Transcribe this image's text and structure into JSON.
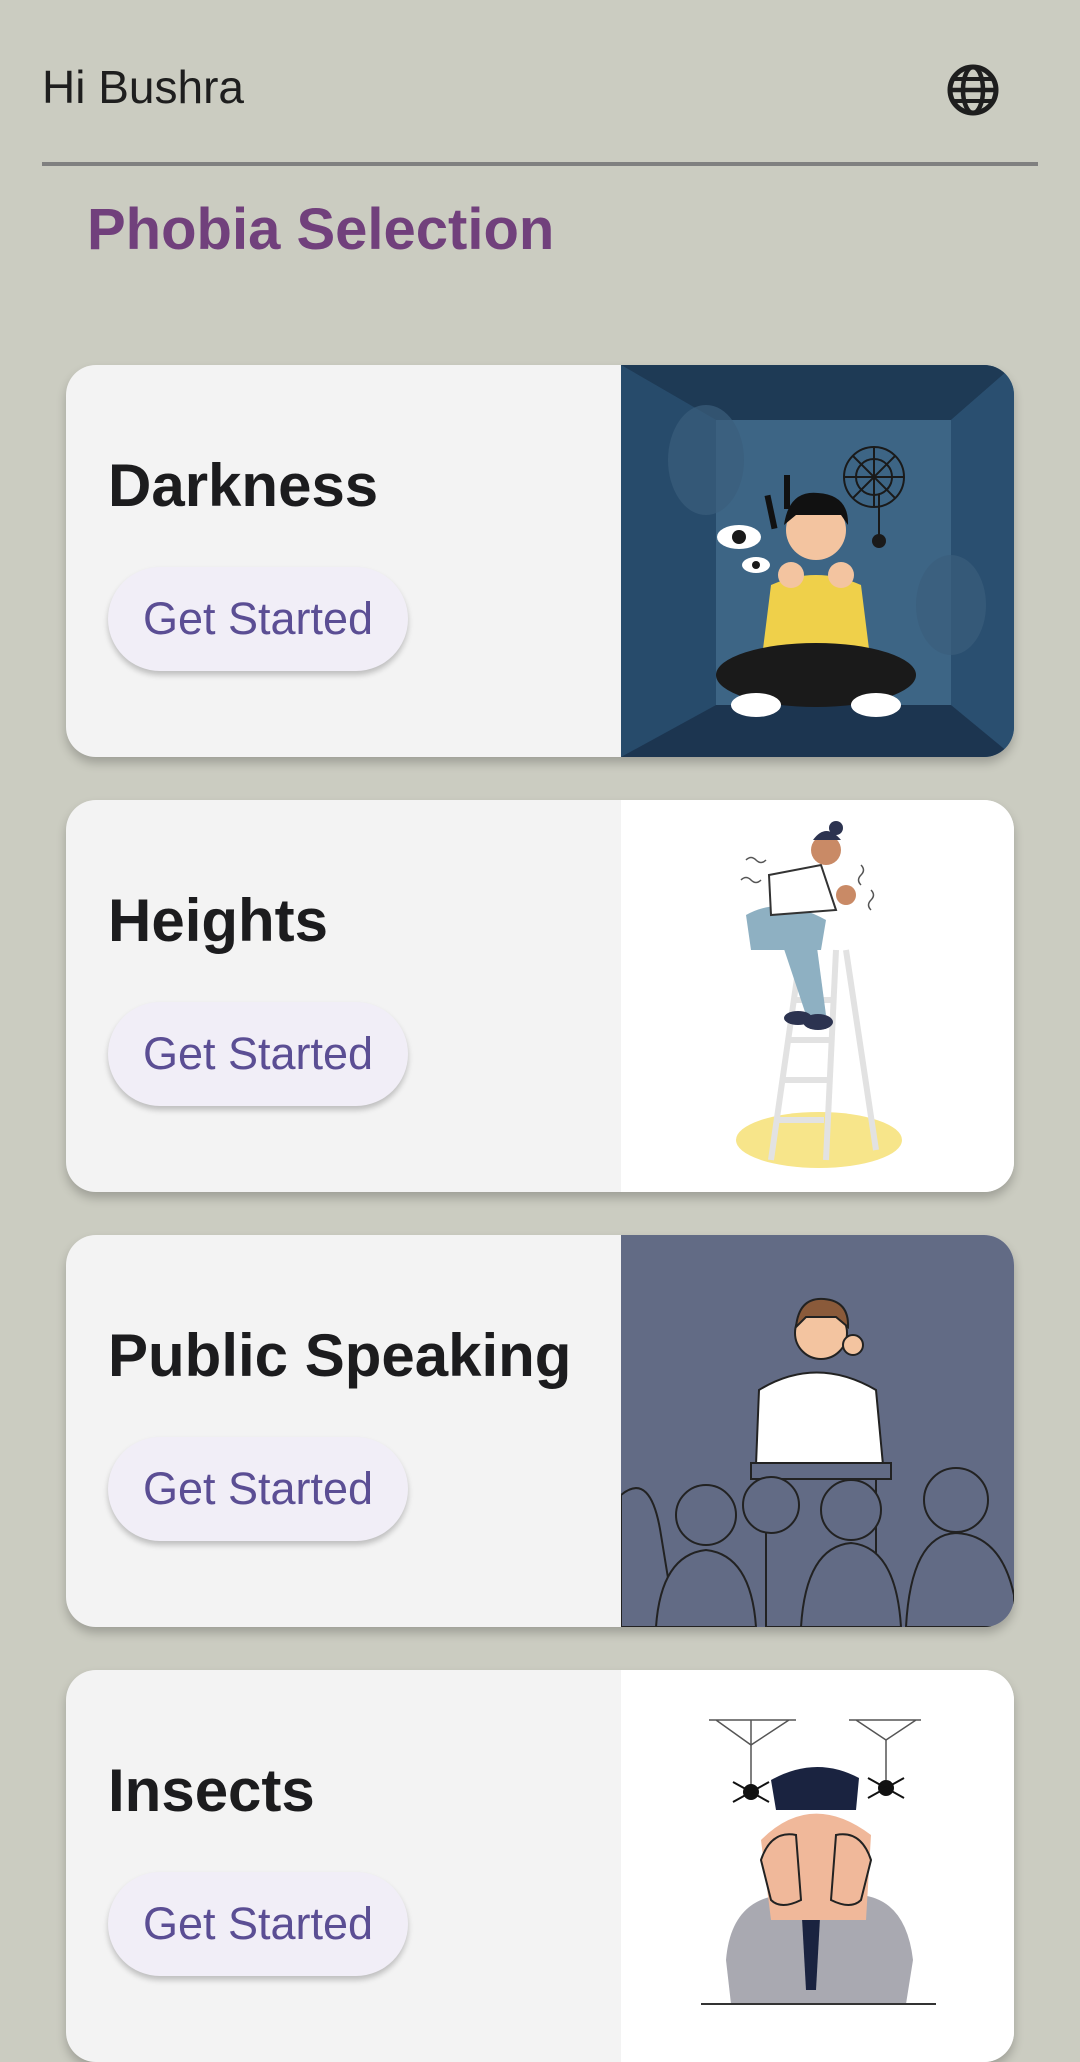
{
  "header": {
    "greeting": "Hi Bushra",
    "language_icon": "globe-icon"
  },
  "page": {
    "title": "Phobia Selection"
  },
  "phobias": [
    {
      "title": "Darkness",
      "button_label": "Get Started",
      "image": "person-scared-in-dark-room-illustration"
    },
    {
      "title": "Heights",
      "button_label": "Get Started",
      "image": "person-afraid-on-ladder-illustration"
    },
    {
      "title": "Public Speaking",
      "button_label": "Get Started",
      "image": "nervous-speaker-at-podium-illustration"
    },
    {
      "title": "Insects",
      "button_label": "Get Started",
      "image": "person-scared-of-spiders-illustration"
    }
  ],
  "colors": {
    "background": "#cbccc1",
    "title_accent": "#71407c",
    "button_text": "#5b4e94",
    "card_background": "#f3f3f3"
  }
}
